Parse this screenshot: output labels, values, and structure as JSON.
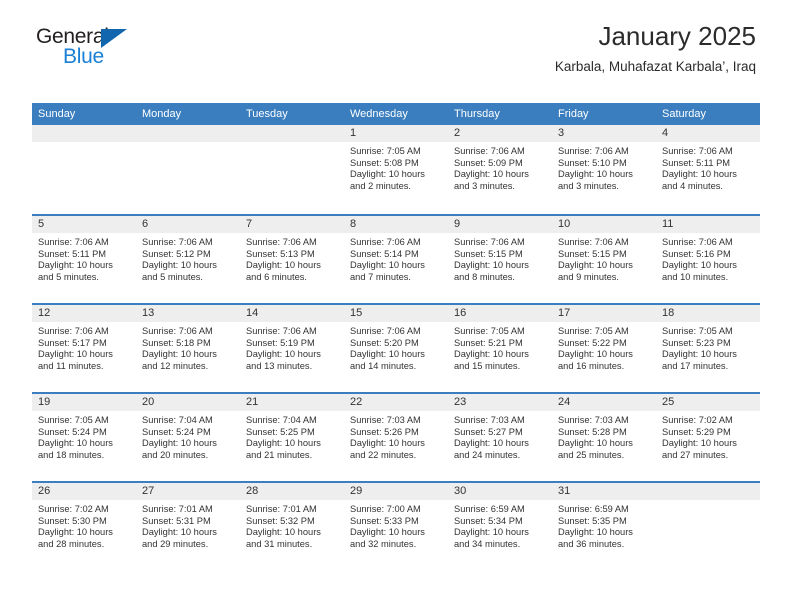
{
  "brand": {
    "line1": "General",
    "line2": "Blue",
    "icon": "triangle-logo-icon",
    "color_dark": "#231f20",
    "color_blue": "#1b7fd4"
  },
  "header": {
    "title": "January 2025",
    "subtitle": "Karbala, Muhafazat Karbala’, Iraq"
  },
  "theme": {
    "header_bg": "#3a7ebf",
    "daynum_bg": "#eeeeee",
    "text": "#333333"
  },
  "weekdays": [
    "Sunday",
    "Monday",
    "Tuesday",
    "Wednesday",
    "Thursday",
    "Friday",
    "Saturday"
  ],
  "weeks": [
    [
      {
        "day": "",
        "sunrise": "",
        "sunset": "",
        "daylight_1": "",
        "daylight_2": ""
      },
      {
        "day": "",
        "sunrise": "",
        "sunset": "",
        "daylight_1": "",
        "daylight_2": ""
      },
      {
        "day": "",
        "sunrise": "",
        "sunset": "",
        "daylight_1": "",
        "daylight_2": ""
      },
      {
        "day": "1",
        "sunrise": "Sunrise: 7:05 AM",
        "sunset": "Sunset: 5:08 PM",
        "daylight_1": "Daylight: 10 hours",
        "daylight_2": "and 2 minutes."
      },
      {
        "day": "2",
        "sunrise": "Sunrise: 7:06 AM",
        "sunset": "Sunset: 5:09 PM",
        "daylight_1": "Daylight: 10 hours",
        "daylight_2": "and 3 minutes."
      },
      {
        "day": "3",
        "sunrise": "Sunrise: 7:06 AM",
        "sunset": "Sunset: 5:10 PM",
        "daylight_1": "Daylight: 10 hours",
        "daylight_2": "and 3 minutes."
      },
      {
        "day": "4",
        "sunrise": "Sunrise: 7:06 AM",
        "sunset": "Sunset: 5:11 PM",
        "daylight_1": "Daylight: 10 hours",
        "daylight_2": "and 4 minutes."
      }
    ],
    [
      {
        "day": "5",
        "sunrise": "Sunrise: 7:06 AM",
        "sunset": "Sunset: 5:11 PM",
        "daylight_1": "Daylight: 10 hours",
        "daylight_2": "and 5 minutes."
      },
      {
        "day": "6",
        "sunrise": "Sunrise: 7:06 AM",
        "sunset": "Sunset: 5:12 PM",
        "daylight_1": "Daylight: 10 hours",
        "daylight_2": "and 5 minutes."
      },
      {
        "day": "7",
        "sunrise": "Sunrise: 7:06 AM",
        "sunset": "Sunset: 5:13 PM",
        "daylight_1": "Daylight: 10 hours",
        "daylight_2": "and 6 minutes."
      },
      {
        "day": "8",
        "sunrise": "Sunrise: 7:06 AM",
        "sunset": "Sunset: 5:14 PM",
        "daylight_1": "Daylight: 10 hours",
        "daylight_2": "and 7 minutes."
      },
      {
        "day": "9",
        "sunrise": "Sunrise: 7:06 AM",
        "sunset": "Sunset: 5:15 PM",
        "daylight_1": "Daylight: 10 hours",
        "daylight_2": "and 8 minutes."
      },
      {
        "day": "10",
        "sunrise": "Sunrise: 7:06 AM",
        "sunset": "Sunset: 5:15 PM",
        "daylight_1": "Daylight: 10 hours",
        "daylight_2": "and 9 minutes."
      },
      {
        "day": "11",
        "sunrise": "Sunrise: 7:06 AM",
        "sunset": "Sunset: 5:16 PM",
        "daylight_1": "Daylight: 10 hours",
        "daylight_2": "and 10 minutes."
      }
    ],
    [
      {
        "day": "12",
        "sunrise": "Sunrise: 7:06 AM",
        "sunset": "Sunset: 5:17 PM",
        "daylight_1": "Daylight: 10 hours",
        "daylight_2": "and 11 minutes."
      },
      {
        "day": "13",
        "sunrise": "Sunrise: 7:06 AM",
        "sunset": "Sunset: 5:18 PM",
        "daylight_1": "Daylight: 10 hours",
        "daylight_2": "and 12 minutes."
      },
      {
        "day": "14",
        "sunrise": "Sunrise: 7:06 AM",
        "sunset": "Sunset: 5:19 PM",
        "daylight_1": "Daylight: 10 hours",
        "daylight_2": "and 13 minutes."
      },
      {
        "day": "15",
        "sunrise": "Sunrise: 7:06 AM",
        "sunset": "Sunset: 5:20 PM",
        "daylight_1": "Daylight: 10 hours",
        "daylight_2": "and 14 minutes."
      },
      {
        "day": "16",
        "sunrise": "Sunrise: 7:05 AM",
        "sunset": "Sunset: 5:21 PM",
        "daylight_1": "Daylight: 10 hours",
        "daylight_2": "and 15 minutes."
      },
      {
        "day": "17",
        "sunrise": "Sunrise: 7:05 AM",
        "sunset": "Sunset: 5:22 PM",
        "daylight_1": "Daylight: 10 hours",
        "daylight_2": "and 16 minutes."
      },
      {
        "day": "18",
        "sunrise": "Sunrise: 7:05 AM",
        "sunset": "Sunset: 5:23 PM",
        "daylight_1": "Daylight: 10 hours",
        "daylight_2": "and 17 minutes."
      }
    ],
    [
      {
        "day": "19",
        "sunrise": "Sunrise: 7:05 AM",
        "sunset": "Sunset: 5:24 PM",
        "daylight_1": "Daylight: 10 hours",
        "daylight_2": "and 18 minutes."
      },
      {
        "day": "20",
        "sunrise": "Sunrise: 7:04 AM",
        "sunset": "Sunset: 5:24 PM",
        "daylight_1": "Daylight: 10 hours",
        "daylight_2": "and 20 minutes."
      },
      {
        "day": "21",
        "sunrise": "Sunrise: 7:04 AM",
        "sunset": "Sunset: 5:25 PM",
        "daylight_1": "Daylight: 10 hours",
        "daylight_2": "and 21 minutes."
      },
      {
        "day": "22",
        "sunrise": "Sunrise: 7:03 AM",
        "sunset": "Sunset: 5:26 PM",
        "daylight_1": "Daylight: 10 hours",
        "daylight_2": "and 22 minutes."
      },
      {
        "day": "23",
        "sunrise": "Sunrise: 7:03 AM",
        "sunset": "Sunset: 5:27 PM",
        "daylight_1": "Daylight: 10 hours",
        "daylight_2": "and 24 minutes."
      },
      {
        "day": "24",
        "sunrise": "Sunrise: 7:03 AM",
        "sunset": "Sunset: 5:28 PM",
        "daylight_1": "Daylight: 10 hours",
        "daylight_2": "and 25 minutes."
      },
      {
        "day": "25",
        "sunrise": "Sunrise: 7:02 AM",
        "sunset": "Sunset: 5:29 PM",
        "daylight_1": "Daylight: 10 hours",
        "daylight_2": "and 27 minutes."
      }
    ],
    [
      {
        "day": "26",
        "sunrise": "Sunrise: 7:02 AM",
        "sunset": "Sunset: 5:30 PM",
        "daylight_1": "Daylight: 10 hours",
        "daylight_2": "and 28 minutes."
      },
      {
        "day": "27",
        "sunrise": "Sunrise: 7:01 AM",
        "sunset": "Sunset: 5:31 PM",
        "daylight_1": "Daylight: 10 hours",
        "daylight_2": "and 29 minutes."
      },
      {
        "day": "28",
        "sunrise": "Sunrise: 7:01 AM",
        "sunset": "Sunset: 5:32 PM",
        "daylight_1": "Daylight: 10 hours",
        "daylight_2": "and 31 minutes."
      },
      {
        "day": "29",
        "sunrise": "Sunrise: 7:00 AM",
        "sunset": "Sunset: 5:33 PM",
        "daylight_1": "Daylight: 10 hours",
        "daylight_2": "and 32 minutes."
      },
      {
        "day": "30",
        "sunrise": "Sunrise: 6:59 AM",
        "sunset": "Sunset: 5:34 PM",
        "daylight_1": "Daylight: 10 hours",
        "daylight_2": "and 34 minutes."
      },
      {
        "day": "31",
        "sunrise": "Sunrise: 6:59 AM",
        "sunset": "Sunset: 5:35 PM",
        "daylight_1": "Daylight: 10 hours",
        "daylight_2": "and 36 minutes."
      },
      {
        "day": "",
        "sunrise": "",
        "sunset": "",
        "daylight_1": "",
        "daylight_2": ""
      }
    ]
  ]
}
